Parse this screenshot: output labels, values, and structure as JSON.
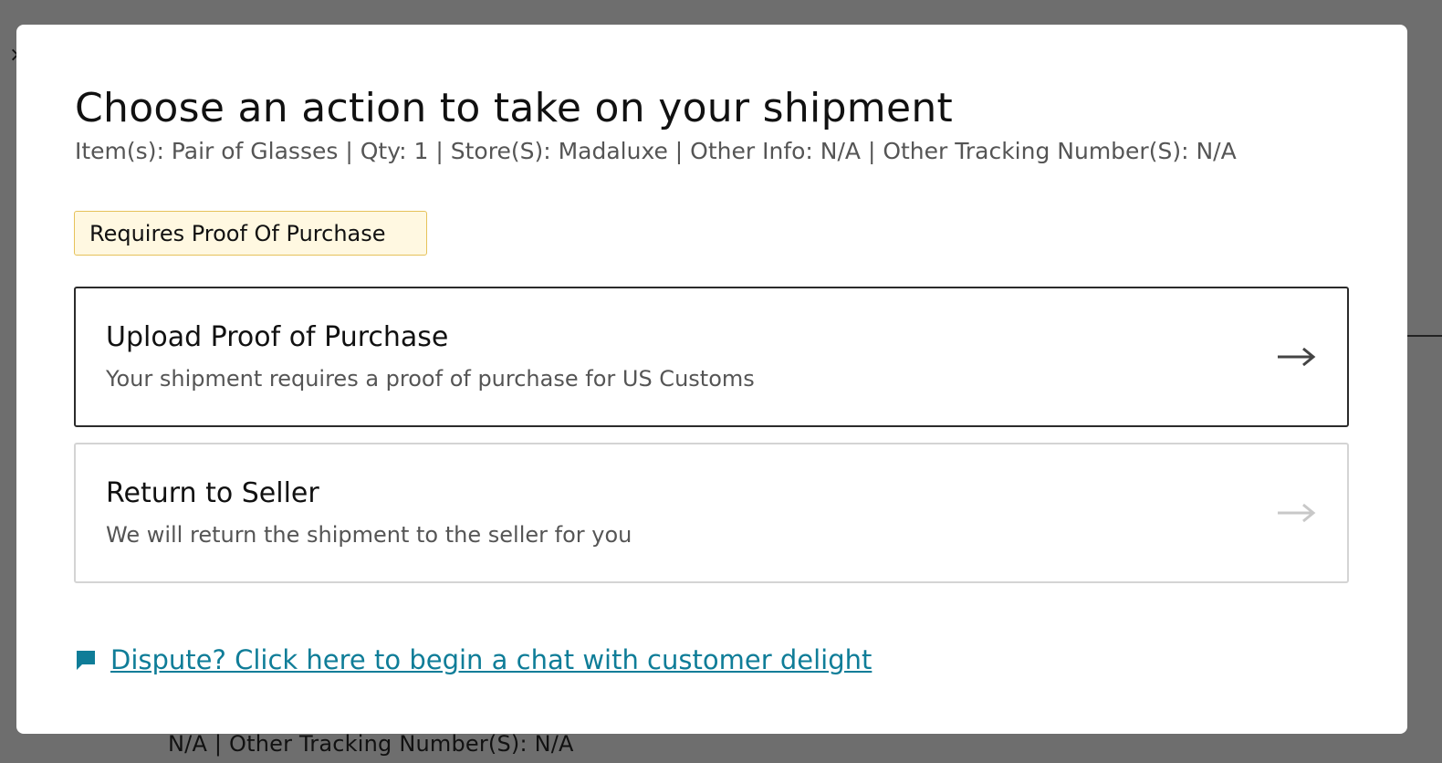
{
  "background": {
    "close_glyph": "×",
    "bottom_text": "N/A | Other Tracking Number(S): N/A"
  },
  "modal": {
    "title": "Choose an action to take on your shipment",
    "subtitle": "Item(s): Pair of Glasses | Qty: 1 | Store(S): Madaluxe | Other Info: N/A | Other Tracking Number(S): N/A",
    "badge": "Requires Proof Of Purchase",
    "actions": [
      {
        "title": "Upload Proof of Purchase",
        "description": "Your shipment requires a proof of purchase for US Customs",
        "icon": "arrow-right-icon",
        "state": "enabled"
      },
      {
        "title": "Return to Seller",
        "description": "We will return the shipment to the seller for you",
        "icon": "arrow-right-icon",
        "state": "muted"
      }
    ],
    "chat_link": {
      "text": "Dispute? Click here to begin a chat with customer delight",
      "icon": "chat-bubble-icon"
    }
  },
  "colors": {
    "backdrop": "#6e6e6e",
    "badge_bg": "#fff8e1",
    "badge_border": "#e6c25a",
    "link": "#0f7d98",
    "primary_border": "#2b2b2b",
    "secondary_border": "#d4d4d4"
  }
}
